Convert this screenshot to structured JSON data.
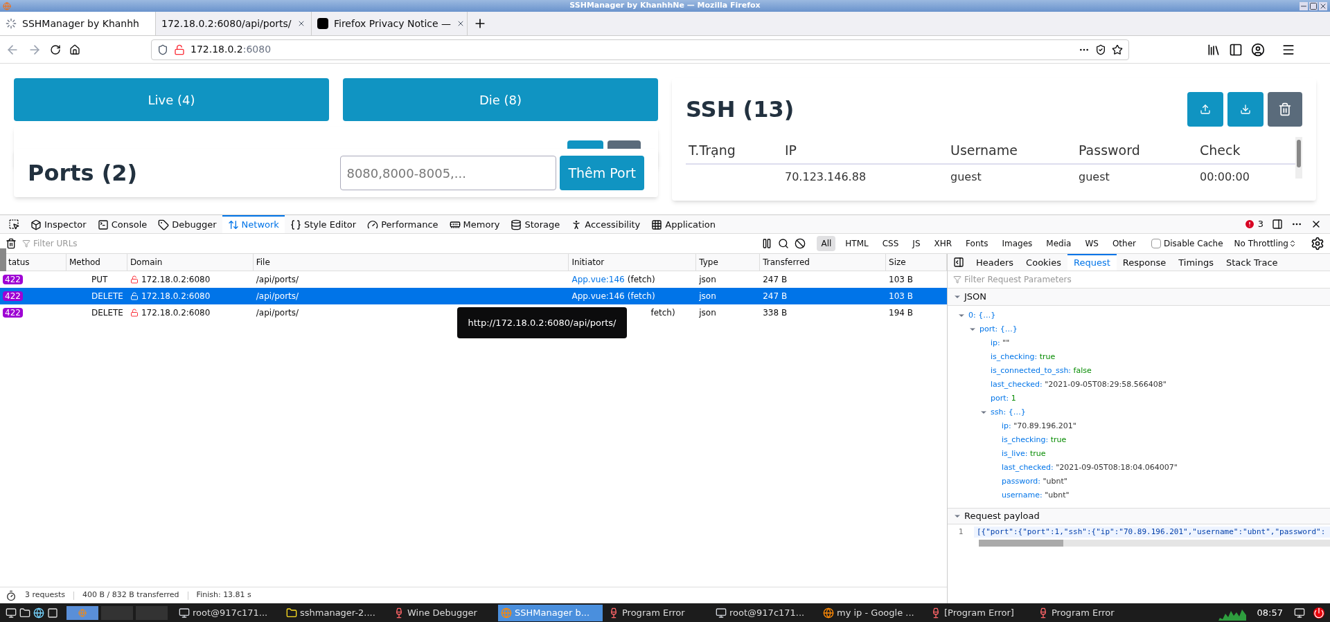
{
  "window": {
    "title": "SSHManager by KhanhhNe — Mozilla Firefox"
  },
  "browser_tabs": [
    {
      "label": "SSHManager by Khanhh",
      "selected": true,
      "kind": "loading"
    },
    {
      "label": "172.18.0.2:6080/api/ports/",
      "selected": false,
      "kind": "none"
    },
    {
      "label": "Firefox Privacy Notice —",
      "selected": false,
      "kind": "logo"
    }
  ],
  "address": {
    "host": "172.18.0.2",
    "port": ":6080"
  },
  "page": {
    "live_button": "Live (4)",
    "die_button": "Die (8)",
    "ports": {
      "title": "Ports (2)",
      "placeholder": "8080,8000-8005,...",
      "add_button": "Thêm Port"
    },
    "ssh": {
      "title": "SSH (13)",
      "columns": [
        "T.Trạng",
        "IP",
        "Username",
        "Password",
        "Check"
      ],
      "rows": [
        {
          "ip": "70.123.146.88",
          "username": "guest",
          "password": "guest",
          "check": "00:00:00"
        }
      ]
    }
  },
  "devtools": {
    "tabs": [
      {
        "label": "Inspector",
        "selected": false
      },
      {
        "label": "Console",
        "selected": false
      },
      {
        "label": "Debugger",
        "selected": false
      },
      {
        "label": "Network",
        "selected": true
      },
      {
        "label": "Style Editor",
        "selected": false
      },
      {
        "label": "Performance",
        "selected": false
      },
      {
        "label": "Memory",
        "selected": false
      },
      {
        "label": "Storage",
        "selected": false
      },
      {
        "label": "Accessibility",
        "selected": false
      },
      {
        "label": "Application",
        "selected": false
      }
    ],
    "error_count": "3",
    "filter_placeholder": "Filter URLs",
    "type_filters": [
      {
        "label": "All",
        "selected": true
      },
      {
        "label": "HTML",
        "selected": false
      },
      {
        "label": "CSS",
        "selected": false
      },
      {
        "label": "JS",
        "selected": false
      },
      {
        "label": "XHR",
        "selected": false
      },
      {
        "label": "Fonts",
        "selected": false
      },
      {
        "label": "Images",
        "selected": false
      },
      {
        "label": "Media",
        "selected": false
      },
      {
        "label": "WS",
        "selected": false
      },
      {
        "label": "Other",
        "selected": false
      }
    ],
    "disable_cache": {
      "label": "Disable Cache",
      "checked": false
    },
    "throttling": "No Throttling",
    "columns": [
      "tatus",
      "Method",
      "Domain",
      "File",
      "Initiator",
      "Type",
      "Transferred",
      "Size"
    ],
    "requests": [
      {
        "status": "422",
        "method": "PUT",
        "domain": "172.18.0.2:6080",
        "file": "/api/ports/",
        "initiator_link": "App.vue:146",
        "initiator_note": "(fetch)",
        "type": "json",
        "transferred": "247 B",
        "size": "103 B",
        "selected": false
      },
      {
        "status": "422",
        "method": "DELETE",
        "domain": "172.18.0.2:6080",
        "file": "/api/ports/",
        "initiator_link": "App.vue:146",
        "initiator_note": "(fetch)",
        "type": "json",
        "transferred": "247 B",
        "size": "103 B",
        "selected": true
      },
      {
        "status": "422",
        "method": "DELETE",
        "domain": "172.18.0.2:6080",
        "file": "/api/ports/",
        "initiator_note": "fetch)",
        "type": "json",
        "transferred": "338 B",
        "size": "194 B",
        "selected": false
      }
    ],
    "tooltip": "http://172.18.0.2:6080/api/ports/",
    "status_bar": {
      "requests": "3 requests",
      "transferred": "400 B / 832 B transferred",
      "finish": "Finish: 13.81 s"
    },
    "detail_tabs": [
      {
        "label": "Headers",
        "selected": false
      },
      {
        "label": "Cookies",
        "selected": false
      },
      {
        "label": "Request",
        "selected": true
      },
      {
        "label": "Response",
        "selected": false
      },
      {
        "label": "Timings",
        "selected": false
      },
      {
        "label": "Stack Trace",
        "selected": false
      }
    ],
    "params_placeholder": "Filter Request Parameters",
    "json_section": {
      "label": "JSON",
      "expanded": true,
      "tree": [
        {
          "key": "0:",
          "value": "{…}",
          "kind": "object",
          "expanded": true,
          "children": [
            {
              "key": "port:",
              "value": "{…}",
              "kind": "object",
              "expanded": true,
              "children": [
                {
                  "key": "ip:",
                  "value": "\"\"",
                  "kind": "string"
                },
                {
                  "key": "is_checking:",
                  "value": "true",
                  "kind": "literal"
                },
                {
                  "key": "is_connected_to_ssh:",
                  "value": "false",
                  "kind": "literal"
                },
                {
                  "key": "last_checked:",
                  "value": "\"2021-09-05T08:29:58.566408\"",
                  "kind": "string"
                },
                {
                  "key": "port:",
                  "value": "1",
                  "kind": "literal"
                },
                {
                  "key": "ssh:",
                  "value": "{…}",
                  "kind": "object",
                  "expanded": true,
                  "children": [
                    {
                      "key": "ip:",
                      "value": "\"70.89.196.201\"",
                      "kind": "string"
                    },
                    {
                      "key": "is_checking:",
                      "value": "true",
                      "kind": "literal"
                    },
                    {
                      "key": "is_live:",
                      "value": "true",
                      "kind": "literal"
                    },
                    {
                      "key": "last_checked:",
                      "value": "\"2021-09-05T08:18:04.064007\"",
                      "kind": "string"
                    },
                    {
                      "key": "password:",
                      "value": "\"ubnt\"",
                      "kind": "string"
                    },
                    {
                      "key": "username:",
                      "value": "\"ubnt\"",
                      "kind": "string"
                    }
                  ]
                }
              ]
            }
          ]
        }
      ]
    },
    "payload_section": {
      "label": "Request payload",
      "expanded": true,
      "line_number": "1",
      "code": "[{\"port\":{\"port\":1,\"ssh\":{\"ip\":\"70.89.196.201\",\"username\":\"ubnt\",\"password\":"
    }
  },
  "taskbar": {
    "windows": [
      {
        "label": "root@917c171...",
        "kind": "terminal",
        "selected": false
      },
      {
        "label": "sshmanager-2....",
        "kind": "folder",
        "selected": false
      },
      {
        "label": "Wine Debugger",
        "kind": "wine",
        "selected": false
      },
      {
        "label": "SSHManager b...",
        "kind": "firefox",
        "selected": true
      },
      {
        "label": "Program Error",
        "kind": "wine",
        "selected": false
      },
      {
        "label": "root@917c171...",
        "kind": "terminal",
        "selected": false
      },
      {
        "label": "my ip - Google ...",
        "kind": "firefox",
        "selected": false
      },
      {
        "label": "[Program Error]",
        "kind": "wine",
        "selected": false
      },
      {
        "label": "Program Error",
        "kind": "wine",
        "selected": false
      }
    ],
    "clock": "08:57"
  }
}
